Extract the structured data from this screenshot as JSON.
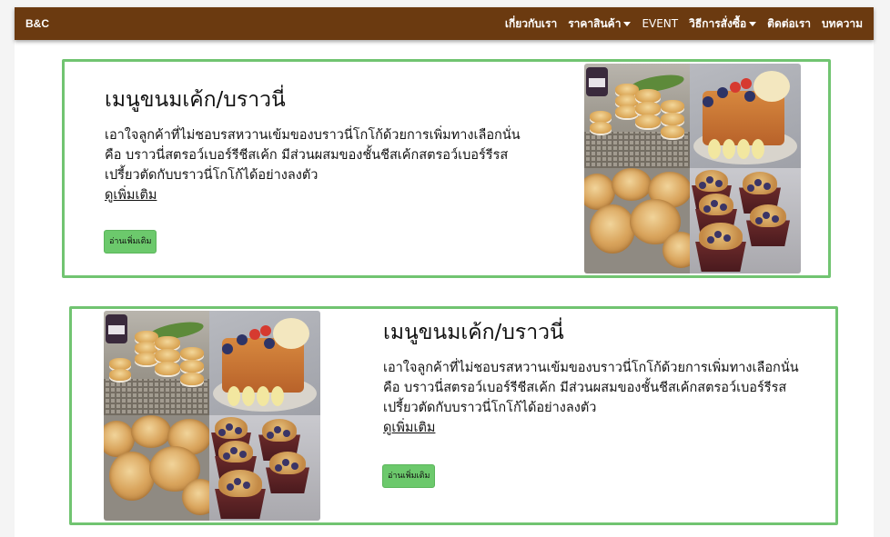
{
  "navbar": {
    "brand": "B&C",
    "links": [
      {
        "label": "เกี่ยวกับเรา",
        "dropdown": false
      },
      {
        "label": "ราคาสินค้า",
        "dropdown": true
      },
      {
        "label": "EVENT",
        "dropdown": false
      },
      {
        "label": "วิธีการสั่งซื้อ",
        "dropdown": true
      },
      {
        "label": "ติดต่อเรา",
        "dropdown": false
      },
      {
        "label": "บทความ",
        "dropdown": false
      }
    ]
  },
  "cards": [
    {
      "title": "เมนูขนมเค้ก/บราวนี่",
      "description": "เอาใจลูกค้าที่ไม่ชอบรสหวานเข้มของบราวนี่โกโก้ด้วยการเพิ่มทางเลือกนั่นคือ บราวนี่สตรอว์เบอร์รีชีสเค้ก มีส่วนผสมของชั้นชีสเค้กสตรอว์เบอร์รีรสเปรี้ยวตัดกับบราวนี่โกโก้ได้อย่างลงตัว",
      "more_link": "ดูเพิ่มเติม",
      "button": "อ่านเพิ่มเติม",
      "image": "dessert-collage"
    },
    {
      "title": "เมนูขนมเค้ก/บราวนี่",
      "description": "เอาใจลูกค้าที่ไม่ชอบรสหวานเข้มของบราวนี่โกโก้ด้วยการเพิ่มทางเลือกนั่นคือ บราวนี่สตรอว์เบอร์รีชีสเค้ก มีส่วนผสมของชั้นชีสเค้กสตรอว์เบอร์รีรสเปรี้ยวตัดกับบราวนี่โกโก้ได้อย่างลงตัว",
      "more_link": "ดูเพิ่มเติม",
      "button": "อ่านเพิ่มเติม",
      "image": "dessert-collage"
    }
  ],
  "colors": {
    "navbar_bg": "#6b3a10",
    "card_border": "#71c471",
    "button_bg": "#6cc96c"
  }
}
